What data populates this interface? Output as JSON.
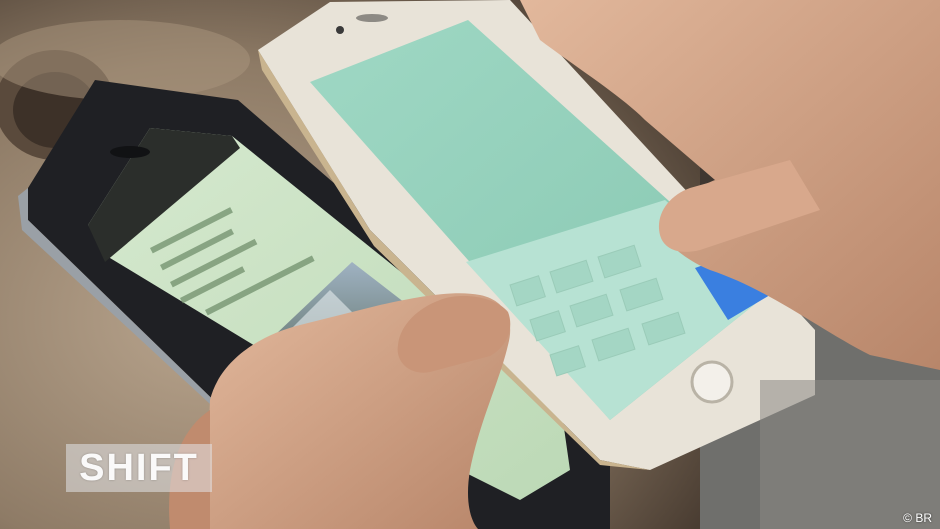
{
  "watermark": {
    "text": "SHIFT"
  },
  "credit": {
    "text": "© BR"
  },
  "colors": {
    "background_table": "#9c8a76",
    "left_phone_body": "#1f2024",
    "left_phone_screen": "#cfe4c9",
    "right_phone_body": "#e8e3d8",
    "right_phone_screen": "#9fd6c2",
    "keyboard_blue_key": "#3a7fe0",
    "skin": "#d6a98c"
  },
  "icons": [
    "home-button-icon",
    "camera-icon",
    "speaker-icon"
  ]
}
